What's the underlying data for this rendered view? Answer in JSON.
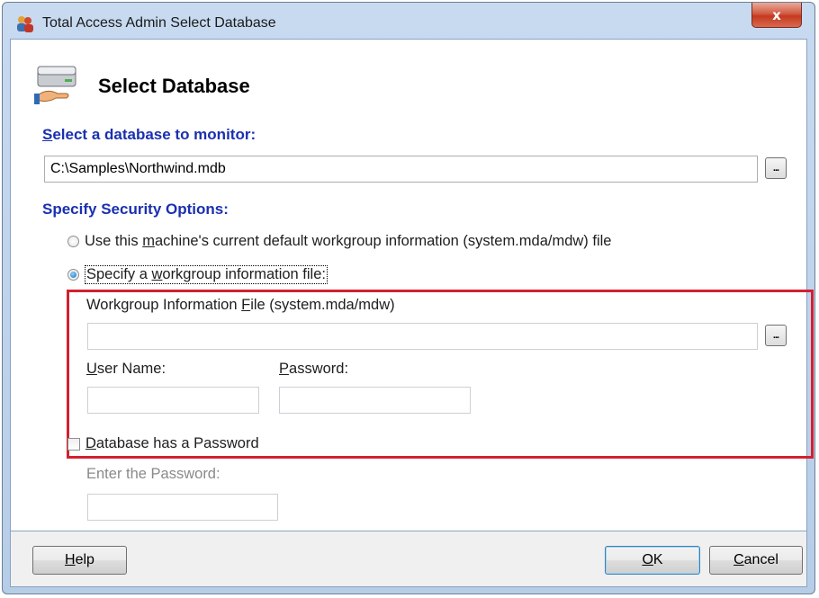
{
  "window": {
    "title": "Total Access Admin Select Database",
    "close_label": "x"
  },
  "header": {
    "title": "Select Database",
    "icon": "database-hand-icon"
  },
  "database": {
    "label_ul": "S",
    "label_rest": "elect a database to monitor:",
    "path": "C:\\Samples\\Northwind.mdb",
    "browse_label": "..."
  },
  "security": {
    "label": "Specify Security Options:",
    "option_default_pre": "Use this ",
    "option_default_ul": "m",
    "option_default_post": "achine's current default workgroup information (system.mda/mdw) file",
    "option_specify_pre": "Specify a ",
    "option_specify_ul": "w",
    "option_specify_post": "orkgroup information file:",
    "selected": "specify",
    "wif_label_pre": "Workgroup Information ",
    "wif_label_ul": "F",
    "wif_label_post": "ile (system.mda/mdw)",
    "wif_value": "",
    "browse_label": "...",
    "username_ul": "U",
    "username_rest": "ser Name:",
    "username_value": "",
    "password_ul": "P",
    "password_rest": "assword:",
    "password_value": "",
    "highlight_color": "#d3202f"
  },
  "db_password": {
    "check_ul": "D",
    "check_rest": "atabase has a Password",
    "checked": false,
    "enter_label": "Enter the Password:",
    "value": ""
  },
  "buttons": {
    "help_ul": "H",
    "help_rest": "elp",
    "ok_ul": "O",
    "ok_rest": "K",
    "cancel_ul": "C",
    "cancel_rest": "ancel"
  }
}
